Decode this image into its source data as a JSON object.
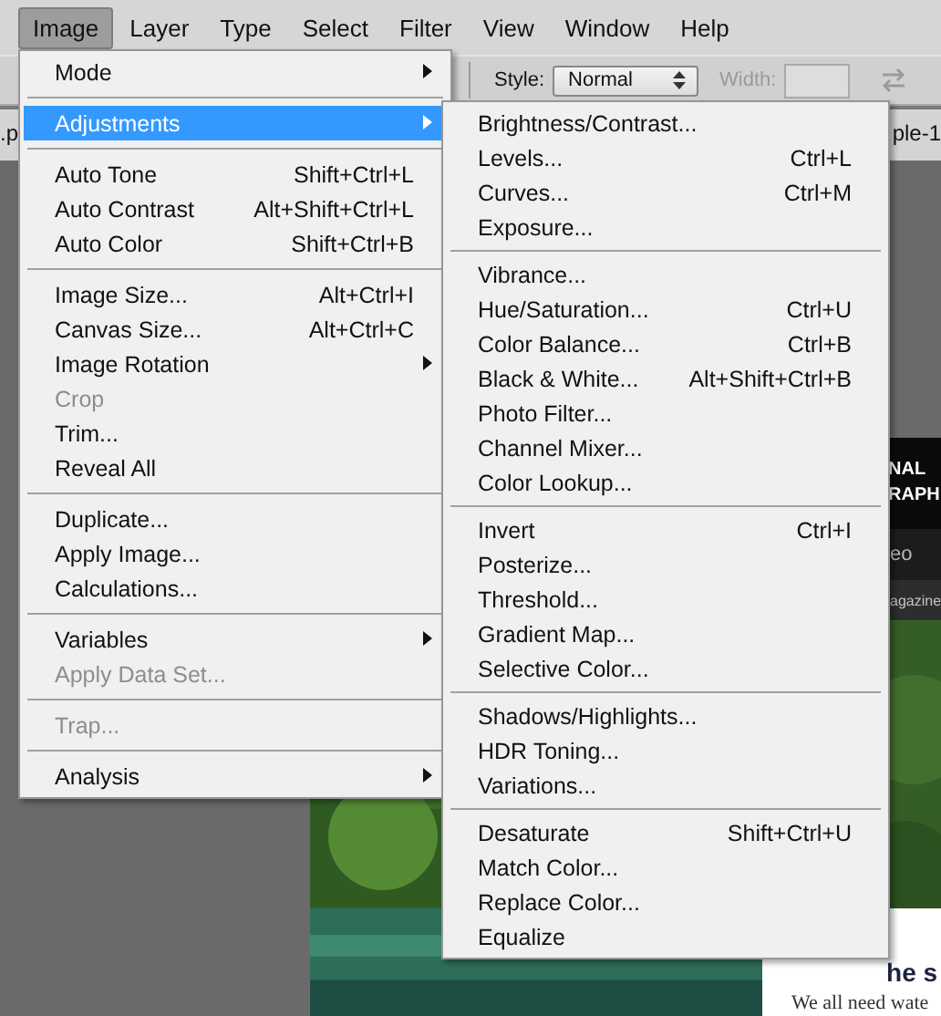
{
  "menu_bar": [
    {
      "label": "Image",
      "selected": true
    },
    {
      "label": "Layer",
      "selected": false
    },
    {
      "label": "Type",
      "selected": false
    },
    {
      "label": "Select",
      "selected": false
    },
    {
      "label": "Filter",
      "selected": false
    },
    {
      "label": "View",
      "selected": false
    },
    {
      "label": "Window",
      "selected": false
    },
    {
      "label": "Help",
      "selected": false
    }
  ],
  "options_bar": {
    "style_label": "Style:",
    "style_value": "Normal",
    "width_label": "Width:"
  },
  "document_tabs": [
    ".p",
    "ple-1"
  ],
  "image_menu": [
    {
      "kind": "item",
      "label": "Mode",
      "submenu": true,
      "disabled": false,
      "selected": false
    },
    {
      "kind": "separator"
    },
    {
      "kind": "item",
      "label": "Adjustments",
      "submenu": true,
      "disabled": false,
      "selected": true
    },
    {
      "kind": "separator"
    },
    {
      "kind": "item",
      "label": "Auto Tone",
      "shortcut": "Shift+Ctrl+L",
      "disabled": false,
      "selected": false
    },
    {
      "kind": "item",
      "label": "Auto Contrast",
      "shortcut": "Alt+Shift+Ctrl+L",
      "disabled": false,
      "selected": false
    },
    {
      "kind": "item",
      "label": "Auto Color",
      "shortcut": "Shift+Ctrl+B",
      "disabled": false,
      "selected": false
    },
    {
      "kind": "separator"
    },
    {
      "kind": "item",
      "label": "Image Size...",
      "shortcut": "Alt+Ctrl+I",
      "disabled": false,
      "selected": false
    },
    {
      "kind": "item",
      "label": "Canvas Size...",
      "shortcut": "Alt+Ctrl+C",
      "disabled": false,
      "selected": false
    },
    {
      "kind": "item",
      "label": "Image Rotation",
      "submenu": true,
      "disabled": false,
      "selected": false
    },
    {
      "kind": "item",
      "label": "Crop",
      "disabled": true,
      "selected": false
    },
    {
      "kind": "item",
      "label": "Trim...",
      "disabled": false,
      "selected": false
    },
    {
      "kind": "item",
      "label": "Reveal All",
      "disabled": false,
      "selected": false
    },
    {
      "kind": "separator"
    },
    {
      "kind": "item",
      "label": "Duplicate...",
      "disabled": false,
      "selected": false
    },
    {
      "kind": "item",
      "label": "Apply Image...",
      "disabled": false,
      "selected": false
    },
    {
      "kind": "item",
      "label": "Calculations...",
      "disabled": false,
      "selected": false
    },
    {
      "kind": "separator"
    },
    {
      "kind": "item",
      "label": "Variables",
      "submenu": true,
      "disabled": false,
      "selected": false
    },
    {
      "kind": "item",
      "label": "Apply Data Set...",
      "disabled": true,
      "selected": false
    },
    {
      "kind": "separator"
    },
    {
      "kind": "item",
      "label": "Trap...",
      "disabled": true,
      "selected": false
    },
    {
      "kind": "separator"
    },
    {
      "kind": "item",
      "label": "Analysis",
      "submenu": true,
      "disabled": false,
      "selected": false
    }
  ],
  "adjustments_submenu": [
    {
      "kind": "item",
      "label": "Brightness/Contrast..."
    },
    {
      "kind": "item",
      "label": "Levels...",
      "shortcut": "Ctrl+L"
    },
    {
      "kind": "item",
      "label": "Curves...",
      "shortcut": "Ctrl+M"
    },
    {
      "kind": "item",
      "label": "Exposure..."
    },
    {
      "kind": "separator"
    },
    {
      "kind": "item",
      "label": "Vibrance..."
    },
    {
      "kind": "item",
      "label": "Hue/Saturation...",
      "shortcut": "Ctrl+U"
    },
    {
      "kind": "item",
      "label": "Color Balance...",
      "shortcut": "Ctrl+B"
    },
    {
      "kind": "item",
      "label": "Black & White...",
      "shortcut": "Alt+Shift+Ctrl+B"
    },
    {
      "kind": "item",
      "label": "Photo Filter..."
    },
    {
      "kind": "item",
      "label": "Channel Mixer..."
    },
    {
      "kind": "item",
      "label": "Color Lookup..."
    },
    {
      "kind": "separator"
    },
    {
      "kind": "item",
      "label": "Invert",
      "shortcut": "Ctrl+I"
    },
    {
      "kind": "item",
      "label": "Posterize..."
    },
    {
      "kind": "item",
      "label": "Threshold..."
    },
    {
      "kind": "item",
      "label": "Gradient Map..."
    },
    {
      "kind": "item",
      "label": "Selective Color..."
    },
    {
      "kind": "separator"
    },
    {
      "kind": "item",
      "label": "Shadows/Highlights..."
    },
    {
      "kind": "item",
      "label": "HDR Toning..."
    },
    {
      "kind": "item",
      "label": "Variations..."
    },
    {
      "kind": "separator"
    },
    {
      "kind": "item",
      "label": "Desaturate",
      "shortcut": "Shift+Ctrl+U"
    },
    {
      "kind": "item",
      "label": "Match Color..."
    },
    {
      "kind": "item",
      "label": "Replace Color..."
    },
    {
      "kind": "item",
      "label": "Equalize"
    }
  ],
  "document": {
    "logo_lines": [
      "NAL",
      "RAPH"
    ],
    "nav_text": "eo",
    "tagline": "agazine",
    "heading": "he s",
    "body": "We all need wate"
  }
}
